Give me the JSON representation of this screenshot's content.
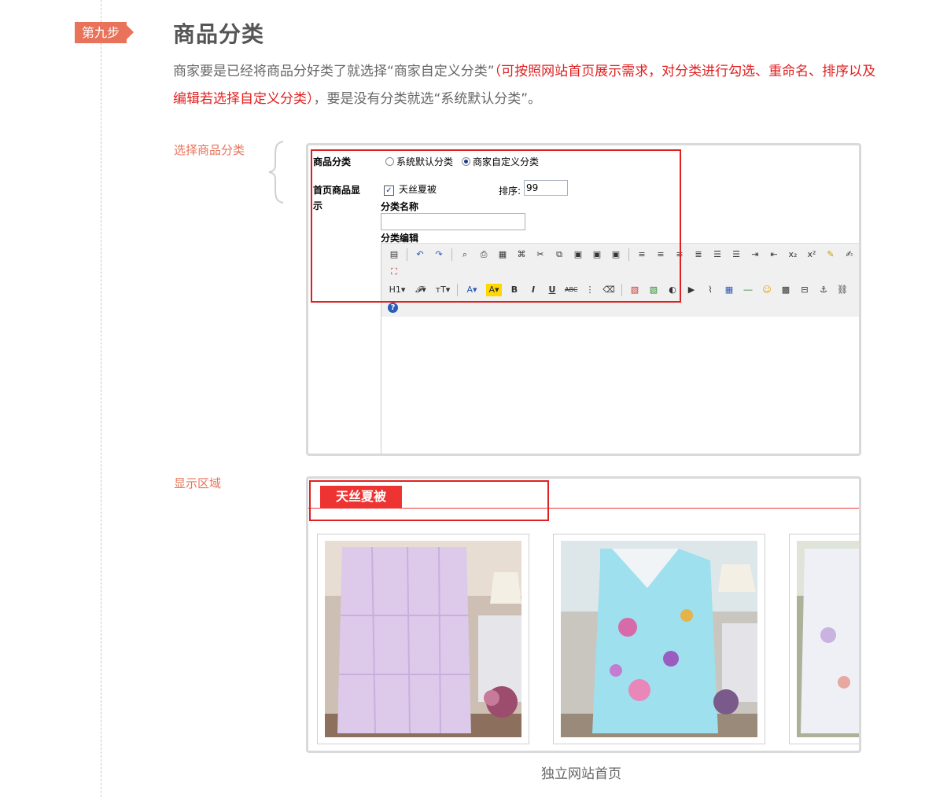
{
  "step": {
    "badge": "第九步"
  },
  "header": {
    "title": "商品分类",
    "desc_part1": "商家要是已经将商品分好类了就选择“商家自定义分类”",
    "desc_red1": "（可按照网站首页展示需求，对分类进行勾选、重命名、",
    "desc_red2": "排序以及编辑若选择自定义分类）",
    "desc_part2": "，要是没有分类就选“系统默认分类”。"
  },
  "labels": {
    "select_category": "选择商品分类",
    "display_area": "显示区域"
  },
  "form": {
    "category_label": "商品分类",
    "radio_default": "系统默认分类",
    "radio_custom": "商家自定义分类",
    "homepage_label_1": "首页商品显",
    "homepage_label_2": "示",
    "checkbox_item": "天丝夏被",
    "sort_label": "排序:",
    "sort_value": "99",
    "name_label": "分类名称",
    "name_value": "",
    "edit_label": "分类编辑"
  },
  "display": {
    "tab_label": "天丝夏被",
    "products": [
      {
        "name": "purple-silk-quilt",
        "palette": [
          "#e9dff1",
          "#cdb9e0"
        ]
      },
      {
        "name": "floral-blue-quilt",
        "palette": [
          "#bfe6ef",
          "#7cc6e0"
        ]
      },
      {
        "name": "floral-white-quilt",
        "palette": [
          "#eef0f5",
          "#cbd4e6"
        ]
      }
    ],
    "caption": "独立网站首页"
  },
  "colors": {
    "accent": "#e8735a",
    "highlight_red": "#e02020",
    "tab_red": "#e33333"
  }
}
